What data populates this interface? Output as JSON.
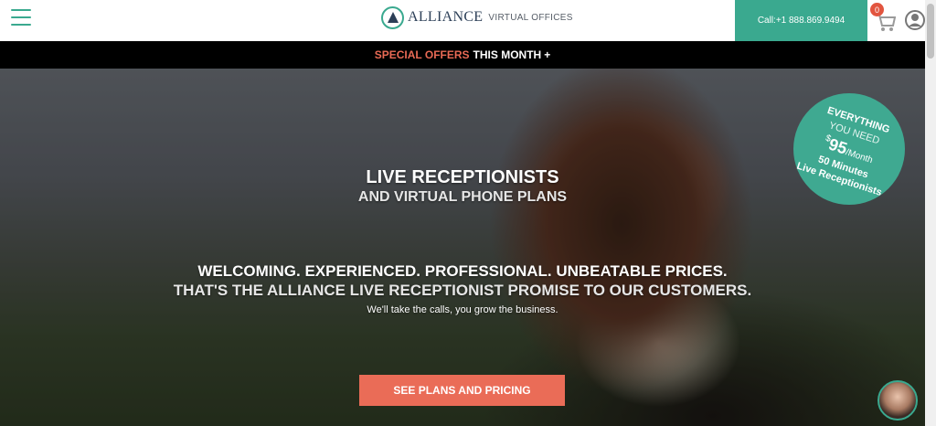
{
  "header": {
    "logo_main": "ALLIANCE",
    "logo_sub": "VIRTUAL OFFICES",
    "call_label": "Call:+1 888.869.9494",
    "cart_count": "0"
  },
  "promo": {
    "accent": "SPECIAL OFFERS",
    "rest": "THIS MONTH",
    "plus": "+"
  },
  "hero": {
    "title": "LIVE RECEPTIONISTS",
    "subtitle": "AND VIRTUAL PHONE PLANS",
    "line1": "WELCOMING. EXPERIENCED. PROFESSIONAL. UNBEATABLE PRICES.",
    "line2": "THAT'S THE ALLIANCE LIVE RECEPTIONIST PROMISE TO OUR CUSTOMERS.",
    "small": "We'll take the calls, you grow the business.",
    "cta_label": "SEE PLANS AND PRICING"
  },
  "badge": {
    "line1": "EVERYTHING",
    "line2": "YOU NEED",
    "currency": "$",
    "price": "95",
    "period": "/Month",
    "line4": "50 Minutes",
    "line5": "Live Receptionists"
  },
  "colors": {
    "brand_green": "#3aa98f",
    "cta_coral": "#ea6c57",
    "promo_accent": "#e96a55",
    "cart_badge": "#e2553f"
  },
  "icons": {
    "menu": "hamburger-menu-icon",
    "cart": "cart-icon",
    "user": "user-icon",
    "chat": "chat-avatar"
  }
}
